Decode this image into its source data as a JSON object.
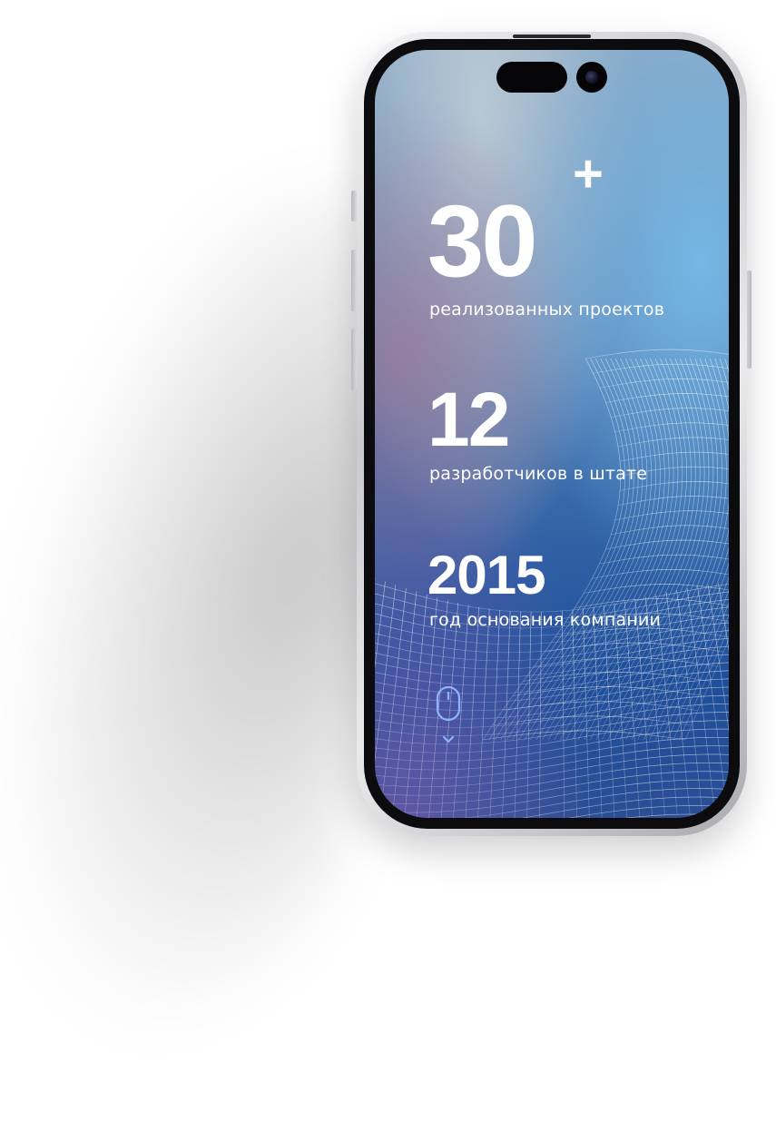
{
  "stats": [
    {
      "value": "30",
      "suffix": "+",
      "label": "реализованных проектов"
    },
    {
      "value": "12",
      "label": "разработчиков в штате"
    },
    {
      "value": "2015",
      "label": "год основания компании"
    }
  ],
  "icons": {
    "scroll": "mouse-icon",
    "scroll_arrow": "chevron-down-icon"
  },
  "colors": {
    "accent": "#8fb4ff",
    "text": "#ffffff",
    "frame": "#0c0c0e"
  }
}
